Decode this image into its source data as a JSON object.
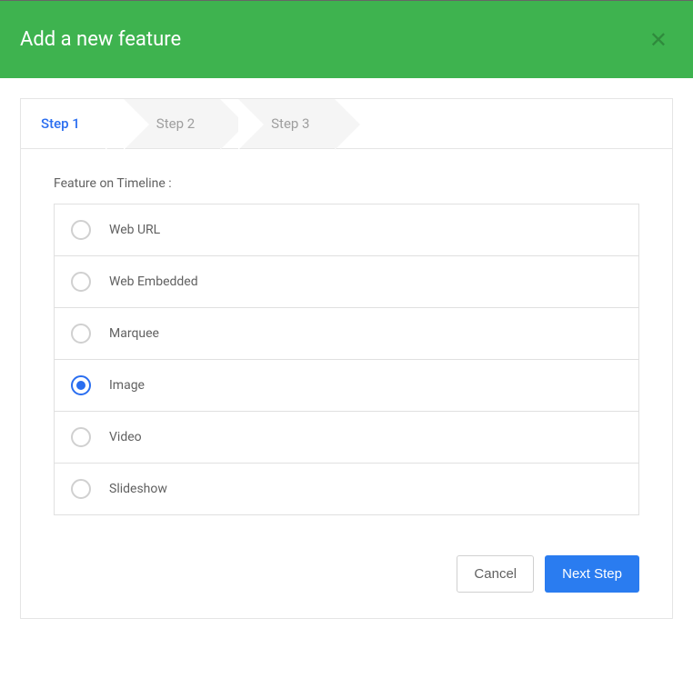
{
  "header": {
    "title": "Add a new feature"
  },
  "steps": [
    {
      "label": "Step 1",
      "active": true
    },
    {
      "label": "Step 2",
      "active": false
    },
    {
      "label": "Step 3",
      "active": false
    }
  ],
  "form": {
    "section_label": "Feature on Timeline :",
    "options": [
      {
        "label": "Web URL",
        "selected": false
      },
      {
        "label": "Web Embedded",
        "selected": false
      },
      {
        "label": "Marquee",
        "selected": false
      },
      {
        "label": "Image",
        "selected": true
      },
      {
        "label": "Video",
        "selected": false
      },
      {
        "label": "Slideshow",
        "selected": false
      }
    ]
  },
  "buttons": {
    "cancel": "Cancel",
    "next": "Next Step"
  }
}
